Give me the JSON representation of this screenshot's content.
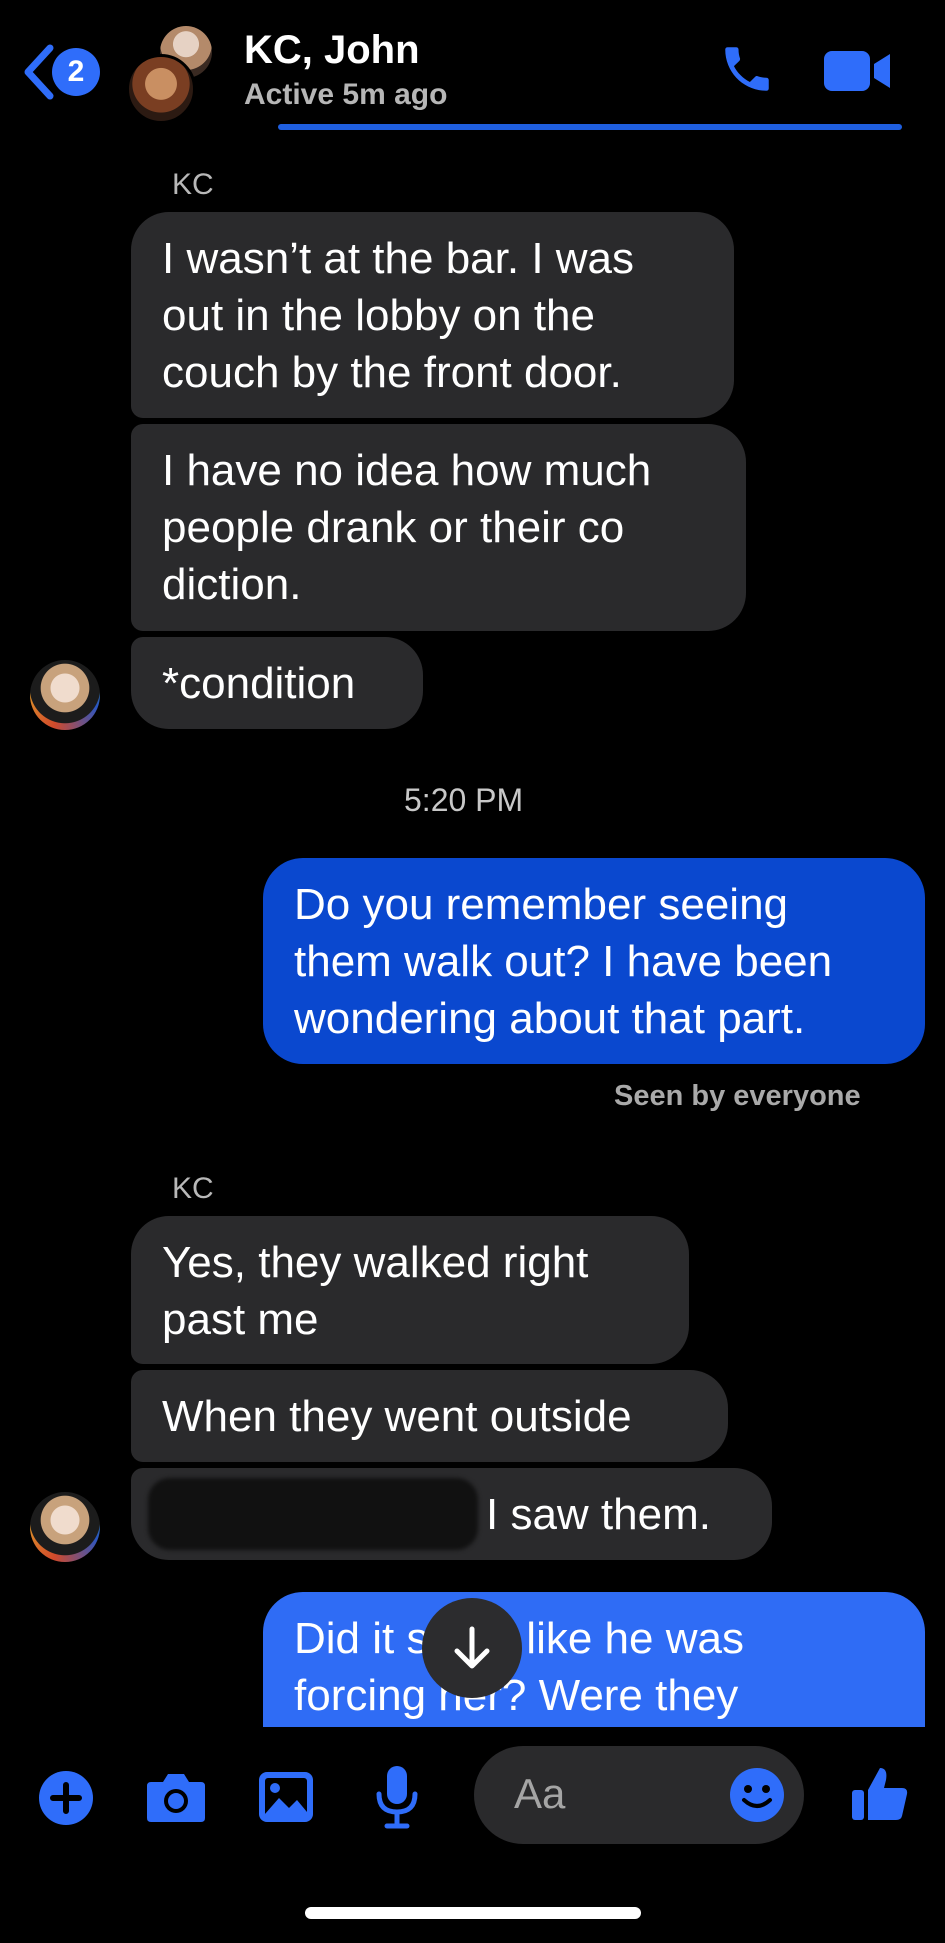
{
  "header": {
    "back_count": "2",
    "title": "KC, John",
    "status": "Active 5m ago",
    "icons": [
      "chevron-left-icon",
      "phone-icon",
      "video-camera-icon"
    ]
  },
  "messages": [
    {
      "type": "sender",
      "text": "KC"
    },
    {
      "type": "incoming",
      "text": "I wasn’t at the bar. I was\nout in the lobby on the\ncouch by the front door."
    },
    {
      "type": "incoming",
      "text": "I have no idea how much\npeople drank or their co\ndiction."
    },
    {
      "type": "incoming",
      "text": "*condition"
    },
    {
      "type": "timestamp",
      "text": "5:20 PM"
    },
    {
      "type": "outgoing",
      "text": "Do you remember seeing\nthem walk out? I have been\nwondering about that part."
    },
    {
      "type": "seen",
      "text": "Seen by everyone"
    },
    {
      "type": "sender",
      "text": "KC"
    },
    {
      "type": "incoming",
      "text": "Yes, they walked right\npast me"
    },
    {
      "type": "incoming",
      "text": "When they went outside"
    },
    {
      "type": "incoming",
      "text": "I saw them."
    },
    {
      "type": "outgoing",
      "text": "Did it seem like he was\nforcing her? Were they"
    }
  ],
  "composer": {
    "placeholder": "Aa",
    "icons": [
      "plus-icon",
      "camera-icon",
      "photo-icon",
      "microphone-icon",
      "emoji-icon",
      "thumbs-up-icon"
    ]
  },
  "colors": {
    "accent": "#2f6dfa",
    "incoming_bubble": "#2a2a2c",
    "outgoing_bubble": "#0a48cf"
  }
}
